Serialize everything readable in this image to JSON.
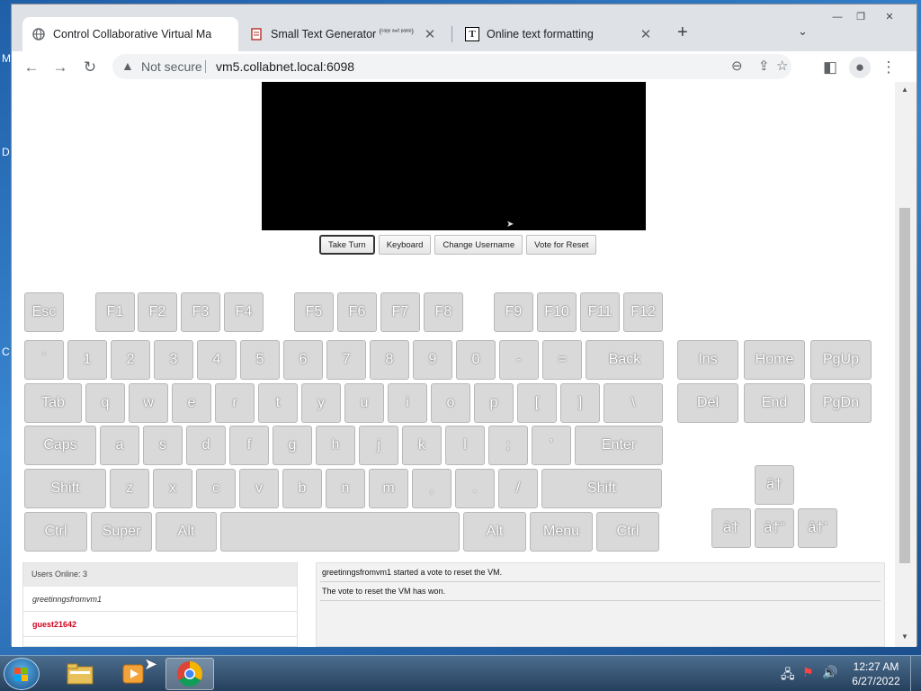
{
  "desktop": {
    "edge_letters": [
      "M",
      "D",
      "C"
    ]
  },
  "browser": {
    "tabs": [
      {
        "title": "Control Collaborative Virtual Ma",
        "icon": "globe-icon",
        "active": true
      },
      {
        "title": "Small Text Generator",
        "superscript": "(ᶜᵒᵖʸ ᵃⁿᵈ ᵖᵃˢᵗᵉ)",
        "icon": "document-icon",
        "active": false
      },
      {
        "title": "Online text formatting",
        "icon": "tf-icon",
        "active": false
      }
    ],
    "omnibox": {
      "security": "Not secure",
      "url": "vm5.collabnet.local:6098"
    }
  },
  "vm_controls": [
    {
      "label": "Take Turn"
    },
    {
      "label": "Keyboard"
    },
    {
      "label": "Change Username"
    },
    {
      "label": "Vote for Reset"
    }
  ],
  "keyboard": {
    "fn_row": [
      "Esc",
      "F1",
      "F2",
      "F3",
      "F4",
      "F5",
      "F6",
      "F7",
      "F8",
      "F9",
      "F10",
      "F11",
      "F12"
    ],
    "number_row": [
      "`",
      "1",
      "2",
      "3",
      "4",
      "5",
      "6",
      "7",
      "8",
      "9",
      "0",
      "-",
      "=",
      "Back"
    ],
    "tab_row": [
      "Tab",
      "q",
      "w",
      "e",
      "r",
      "t",
      "y",
      "u",
      "i",
      "o",
      "p",
      "[",
      "]",
      "\\"
    ],
    "caps_row": [
      "Caps",
      "a",
      "s",
      "d",
      "f",
      "g",
      "h",
      "j",
      "k",
      "l",
      ";",
      "'",
      "Enter"
    ],
    "shift_row": [
      "Shift",
      "z",
      "x",
      "c",
      "v",
      "b",
      "n",
      "m",
      ",",
      ".",
      "/",
      "Shift"
    ],
    "bottom_row": [
      "Ctrl",
      "Super",
      "Alt",
      "",
      "Alt",
      "Menu",
      "Ctrl"
    ],
    "nav_row1": [
      "Ins",
      "Home",
      "PgUp"
    ],
    "nav_row2": [
      "Del",
      "End",
      "PgDn"
    ],
    "arrows": [
      "â†",
      "â†",
      "â†“",
      "â†’"
    ]
  },
  "users": {
    "header": "Users Online: 3",
    "list": [
      "greetinngsfromvm1",
      "guest21642"
    ]
  },
  "chat": [
    "greetinngsfromvm1 started a vote to reset the VM.",
    "The vote to reset the VM has won."
  ],
  "taskbar": {
    "time": "12:27 AM",
    "date": "6/27/2022"
  }
}
